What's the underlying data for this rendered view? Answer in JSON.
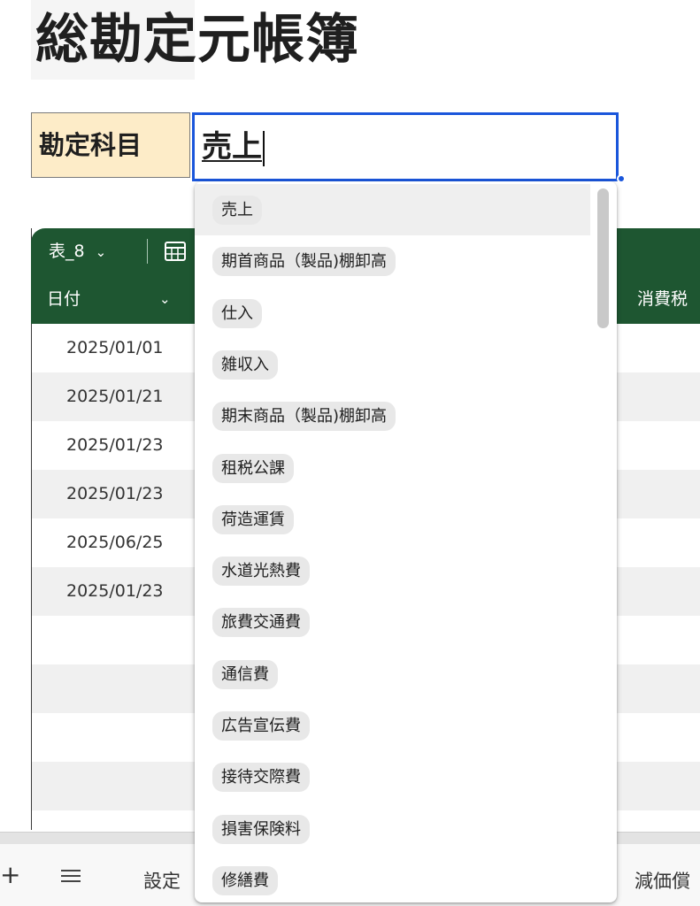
{
  "sheet": {
    "title": "総勘定元帳簿"
  },
  "account": {
    "label": "勘定科目",
    "value": "売上"
  },
  "table": {
    "name": "表_8",
    "columns": {
      "date": "日付",
      "tax": "消費税"
    },
    "rows": [
      {
        "date": "2025/01/01"
      },
      {
        "date": "2025/01/21"
      },
      {
        "date": "2025/01/23"
      },
      {
        "date": "2025/01/23"
      },
      {
        "date": "2025/06/25"
      },
      {
        "date": "2025/01/23"
      },
      {
        "date": ""
      },
      {
        "date": ""
      },
      {
        "date": ""
      },
      {
        "date": ""
      },
      {
        "date": ""
      }
    ]
  },
  "dropdown": {
    "options": [
      "売上",
      "期首商品（製品)棚卸高",
      "仕入",
      "雑収入",
      "期末商品（製品)棚卸高",
      "租税公課",
      "荷造運賃",
      "水道光熱費",
      "旅費交通費",
      "通信費",
      "広告宣伝費",
      "接待交際費",
      "損害保険料",
      "修繕費"
    ],
    "selected_option": "売上"
  },
  "sheet_bar": {
    "add_symbol": "+",
    "tabs": {
      "settings": "設定",
      "depreciation": "減価償"
    }
  },
  "icons": {
    "table_chevron": "chevron-down-icon",
    "table_calc": "calculator-icon",
    "sheet_menu": "menu-icon"
  },
  "colors": {
    "table_header": "#1e5631",
    "label_fill": "#fdecc8",
    "input_border": "#1a56db",
    "chip_fill": "#e8e8e8",
    "row_band": "#f0f0f0"
  }
}
